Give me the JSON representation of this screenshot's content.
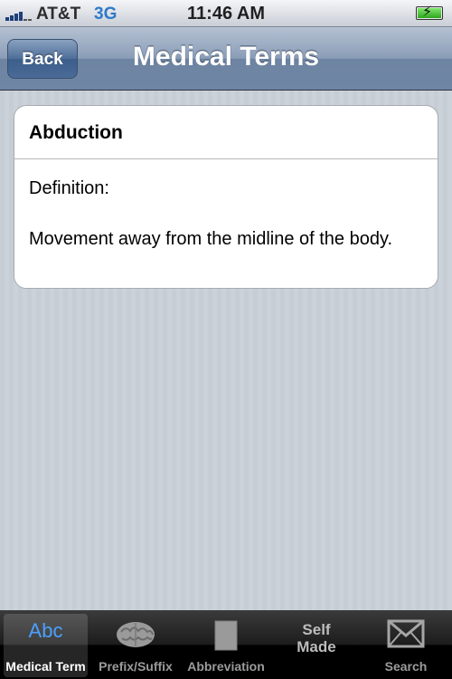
{
  "status_bar": {
    "carrier": "AT&T",
    "network": "3G",
    "time": "11:46 AM"
  },
  "nav_bar": {
    "back_label": "Back",
    "title": "Medical Terms"
  },
  "entry": {
    "term": "Abduction",
    "definition_label": "Definition:",
    "definition": "Movement away from the midline of the body."
  },
  "tab_bar": {
    "tabs": [
      {
        "label": "Medical Term",
        "icon": "abc-icon",
        "icon_text": "Abc",
        "selected": true
      },
      {
        "label": "Prefix/Suffix",
        "icon": "brain-icon",
        "selected": false
      },
      {
        "label": "Abbreviation",
        "icon": "square-icon",
        "selected": false
      },
      {
        "label": "",
        "icon": "self-made-icon",
        "icon_text_line1": "Self",
        "icon_text_line2": "Made",
        "selected": false
      },
      {
        "label": "Search",
        "icon": "envelope-icon",
        "selected": false
      }
    ]
  },
  "colors": {
    "accent": "#4aa0ff",
    "nav_bar": "#6f86a4",
    "background": "#c5ccd4"
  }
}
